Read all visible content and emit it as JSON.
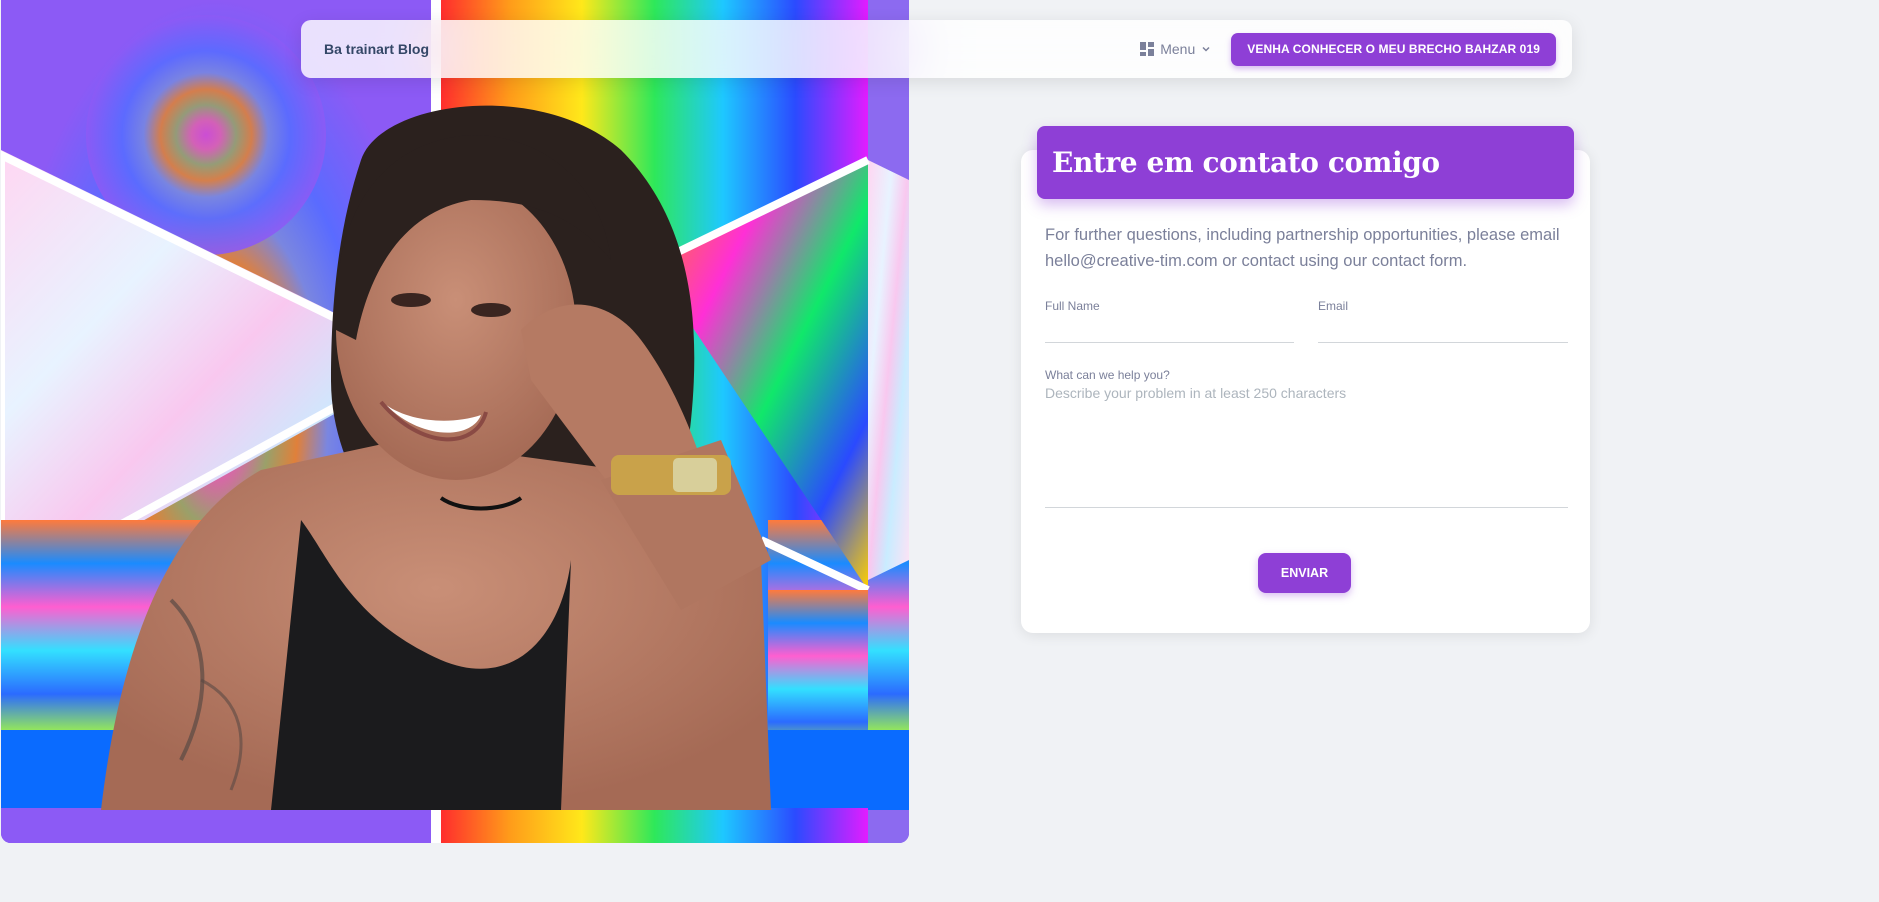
{
  "navbar": {
    "brand": "Ba trainart Blog",
    "menu_label": "Menu",
    "cta_label": "VENHA CONHECER O MEU BRECHO BAHZAR 019"
  },
  "hero": {
    "image_description_icon": "portrait-photo"
  },
  "contact": {
    "title": "Entre em contato comigo",
    "intro": "For further questions, including partnership opportunities, please email hello@creative-tim.com or contact using our contact form.",
    "full_name_label": "Full Name",
    "full_name_value": "",
    "email_label": "Email",
    "email_value": "",
    "message_label": "What can we help you?",
    "message_placeholder": "Describe your problem in at least 250 characters",
    "submit_label": "ENVIAR"
  },
  "colors": {
    "accent": "#8e3fd6",
    "background": "#f0f2f5",
    "text_muted": "#7b809a"
  }
}
